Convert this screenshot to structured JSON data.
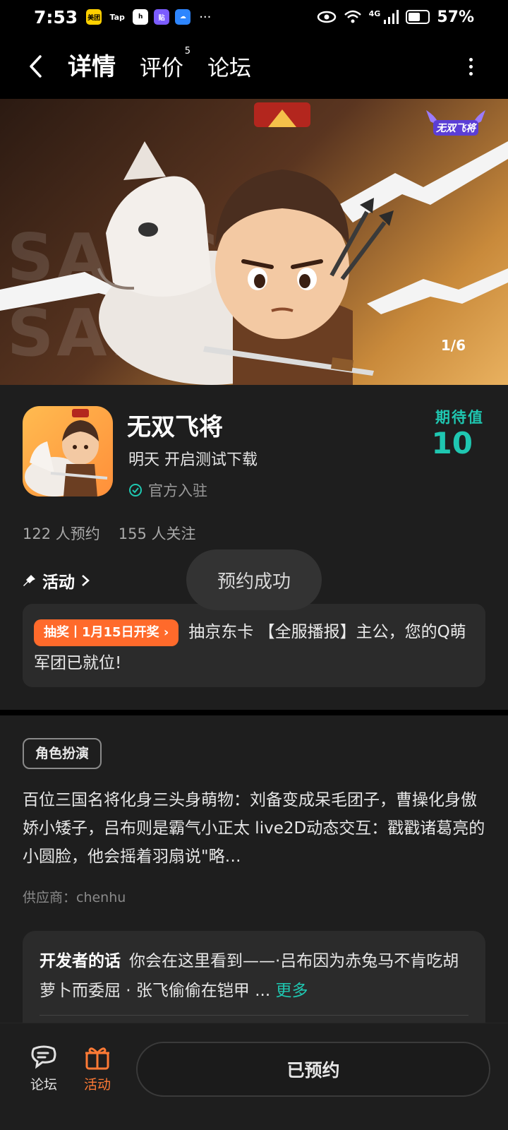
{
  "status_bar": {
    "time": "7:53",
    "notif_labels": [
      "美团",
      "Tap",
      "h",
      "贴",
      "☁"
    ],
    "more": "···",
    "signal_label": "4G",
    "battery": "57%"
  },
  "nav": {
    "tabs": [
      {
        "label": "详情",
        "active": true
      },
      {
        "label": "评价",
        "badge": "5"
      },
      {
        "label": "论坛"
      }
    ]
  },
  "banner": {
    "bg_text": "SANGUO SANGUI",
    "counter": "1/6",
    "logo_text": "无双飞将"
  },
  "game": {
    "title": "无双飞将",
    "subtitle": "明天 开启测试下载",
    "official": "官方入驻",
    "expect_label": "期待值",
    "expect_value": "10",
    "reservations": "122 人预约",
    "followers": "155 人关注"
  },
  "activity": {
    "header": "活动",
    "tag": "抽奖丨1月15日开奖 ›",
    "text": "抽京东卡 【全服播报】主公，您的Q萌军团已就位!"
  },
  "toast": "预约成功",
  "description": {
    "genre": "角色扮演",
    "text": "百位三国名将化身三头身萌物：刘备变成呆毛团子，曹操化身傲娇小矮子，吕布则是霸气小正太 live2D动态交互：戳戳诸葛亮的小圆脸，他会摇着羽扇说\"略…",
    "supplier": "供应商：chenhu"
  },
  "dev_words": {
    "title": "开发者的话",
    "text": "你会在这里看到——·吕布因为赤兔马不肯吃胡萝卜而委屈 · 张飞偷偷在铠甲 ...",
    "more": "更多"
  },
  "bottom": {
    "forum_label": "论坛",
    "activity_label": "活动",
    "reserved_label": "已预约"
  },
  "colors": {
    "accent": "#1fc7b1",
    "orange": "#ff6a2b",
    "background": "#1e1e1e"
  }
}
